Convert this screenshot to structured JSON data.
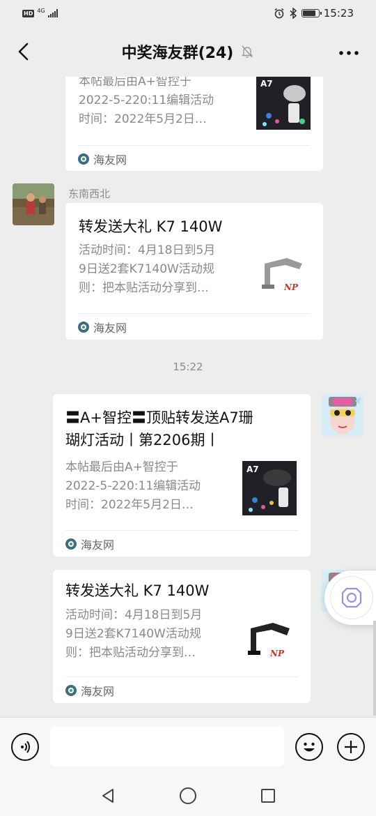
{
  "status_bar": {
    "hd": "HD",
    "network": "4G",
    "time": "15:23",
    "battery_level": 0.85
  },
  "nav": {
    "title": "中奖海友群(24)",
    "back_icon": "chevron-left-icon",
    "mute_icon": "bell-off-icon",
    "more_icon": "more-dots-icon"
  },
  "messages": [
    {
      "desc": "本帖最后由A+智控于2022-5-220:11编辑活动时间：2022年5月2日...",
      "desc_lines": [
        "本帖最后由A+智控于",
        "2022-5-220:11编辑活动",
        "时间：2022年5月2日…"
      ],
      "source": "海友网",
      "thumb_label": "A7"
    },
    {
      "sender": "东南西北",
      "title": "转发送大礼 K7 140W",
      "desc_lines": [
        "活动时间：4月18日到5月",
        "9日送2套K7140W活动规",
        "则：把本贴活动分享到…"
      ],
      "source": "海友网",
      "thumb_label": "NP"
    },
    {
      "title_lines": [
        "〓A+智控〓顶贴转发送A7珊",
        "瑚灯活动丨第2206期丨"
      ],
      "desc_lines": [
        "本帖最后由A+智控于",
        "2022-5-220:11编辑活动",
        "时间：2022年5月2日…"
      ],
      "source": "海友网",
      "thumb_label": "A7"
    },
    {
      "title": "转发送大礼 K7 140W",
      "desc_lines": [
        "活动时间：4月18日到5月",
        "9日送2套K7140W活动规",
        "则：把本贴活动分享到…"
      ],
      "source": "海友网",
      "thumb_label": "NP"
    }
  ],
  "time_separator": "15:22",
  "input_bar": {
    "voice_icon": "voice-icon",
    "placeholder": "",
    "emoji_icon": "emoji-icon",
    "plus_icon": "plus-icon"
  },
  "system_nav": {
    "back": "back-triangle-icon",
    "home": "home-circle-icon",
    "recents": "recents-square-icon"
  }
}
